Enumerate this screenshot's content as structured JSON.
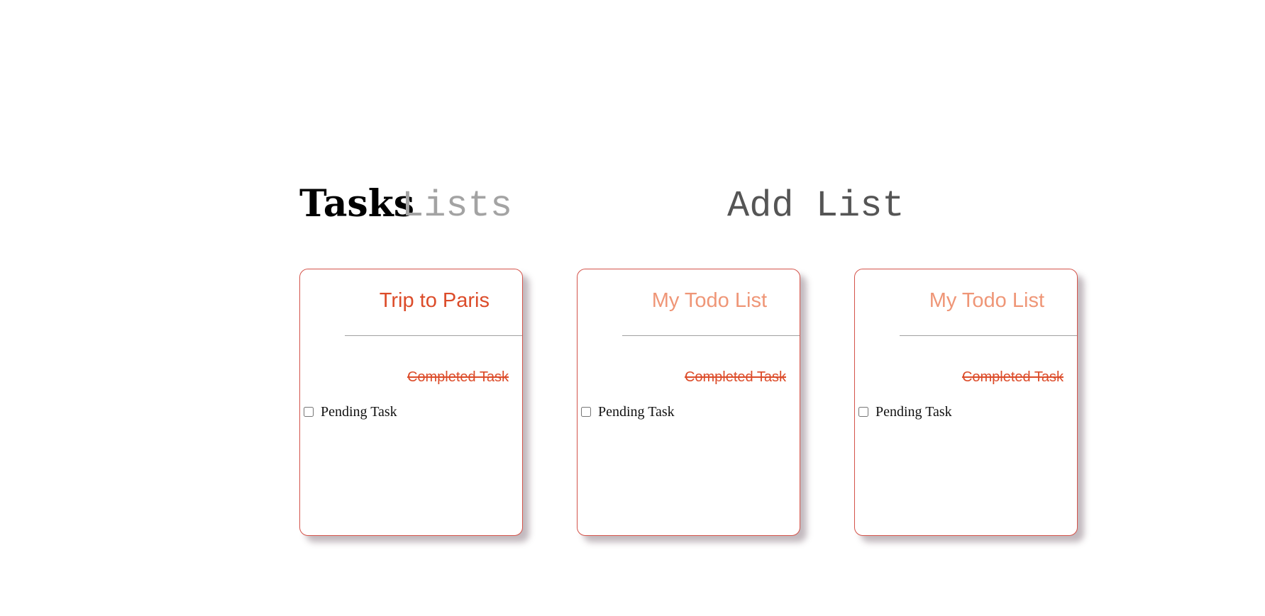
{
  "nav": {
    "tasks_label": "Tasks",
    "lists_label": "Lists",
    "add_list_label": "Add List"
  },
  "lists": [
    {
      "title": "Trip to Paris",
      "completed_task": "Completed Task",
      "pending_task": "Pending Task",
      "active": true
    },
    {
      "title": "My Todo List",
      "completed_task": "Completed Task",
      "pending_task": "Pending Task",
      "active": false
    },
    {
      "title": "My Todo List",
      "completed_task": "Completed Task",
      "pending_task": "Pending Task",
      "active": false
    }
  ],
  "colors": {
    "accent": "#dc4c2a",
    "accent_muted": "#ef9677",
    "card_border": "#d4534a"
  }
}
